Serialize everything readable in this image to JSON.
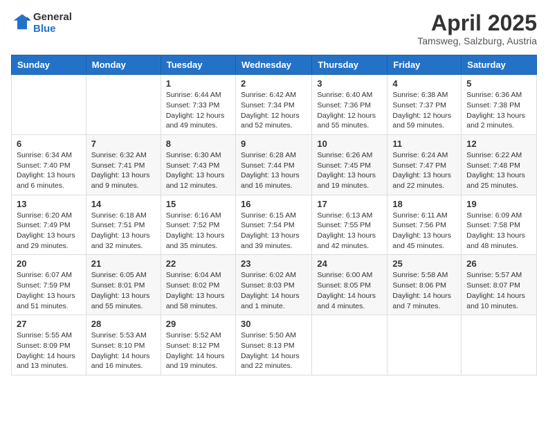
{
  "header": {
    "logo_general": "General",
    "logo_blue": "Blue",
    "month": "April 2025",
    "location": "Tamsweg, Salzburg, Austria"
  },
  "days_of_week": [
    "Sunday",
    "Monday",
    "Tuesday",
    "Wednesday",
    "Thursday",
    "Friday",
    "Saturday"
  ],
  "weeks": [
    [
      {
        "day": "",
        "info": ""
      },
      {
        "day": "",
        "info": ""
      },
      {
        "day": "1",
        "info": "Sunrise: 6:44 AM\nSunset: 7:33 PM\nDaylight: 12 hours and 49 minutes."
      },
      {
        "day": "2",
        "info": "Sunrise: 6:42 AM\nSunset: 7:34 PM\nDaylight: 12 hours and 52 minutes."
      },
      {
        "day": "3",
        "info": "Sunrise: 6:40 AM\nSunset: 7:36 PM\nDaylight: 12 hours and 55 minutes."
      },
      {
        "day": "4",
        "info": "Sunrise: 6:38 AM\nSunset: 7:37 PM\nDaylight: 12 hours and 59 minutes."
      },
      {
        "day": "5",
        "info": "Sunrise: 6:36 AM\nSunset: 7:38 PM\nDaylight: 13 hours and 2 minutes."
      }
    ],
    [
      {
        "day": "6",
        "info": "Sunrise: 6:34 AM\nSunset: 7:40 PM\nDaylight: 13 hours and 6 minutes."
      },
      {
        "day": "7",
        "info": "Sunrise: 6:32 AM\nSunset: 7:41 PM\nDaylight: 13 hours and 9 minutes."
      },
      {
        "day": "8",
        "info": "Sunrise: 6:30 AM\nSunset: 7:43 PM\nDaylight: 13 hours and 12 minutes."
      },
      {
        "day": "9",
        "info": "Sunrise: 6:28 AM\nSunset: 7:44 PM\nDaylight: 13 hours and 16 minutes."
      },
      {
        "day": "10",
        "info": "Sunrise: 6:26 AM\nSunset: 7:45 PM\nDaylight: 13 hours and 19 minutes."
      },
      {
        "day": "11",
        "info": "Sunrise: 6:24 AM\nSunset: 7:47 PM\nDaylight: 13 hours and 22 minutes."
      },
      {
        "day": "12",
        "info": "Sunrise: 6:22 AM\nSunset: 7:48 PM\nDaylight: 13 hours and 25 minutes."
      }
    ],
    [
      {
        "day": "13",
        "info": "Sunrise: 6:20 AM\nSunset: 7:49 PM\nDaylight: 13 hours and 29 minutes."
      },
      {
        "day": "14",
        "info": "Sunrise: 6:18 AM\nSunset: 7:51 PM\nDaylight: 13 hours and 32 minutes."
      },
      {
        "day": "15",
        "info": "Sunrise: 6:16 AM\nSunset: 7:52 PM\nDaylight: 13 hours and 35 minutes."
      },
      {
        "day": "16",
        "info": "Sunrise: 6:15 AM\nSunset: 7:54 PM\nDaylight: 13 hours and 39 minutes."
      },
      {
        "day": "17",
        "info": "Sunrise: 6:13 AM\nSunset: 7:55 PM\nDaylight: 13 hours and 42 minutes."
      },
      {
        "day": "18",
        "info": "Sunrise: 6:11 AM\nSunset: 7:56 PM\nDaylight: 13 hours and 45 minutes."
      },
      {
        "day": "19",
        "info": "Sunrise: 6:09 AM\nSunset: 7:58 PM\nDaylight: 13 hours and 48 minutes."
      }
    ],
    [
      {
        "day": "20",
        "info": "Sunrise: 6:07 AM\nSunset: 7:59 PM\nDaylight: 13 hours and 51 minutes."
      },
      {
        "day": "21",
        "info": "Sunrise: 6:05 AM\nSunset: 8:01 PM\nDaylight: 13 hours and 55 minutes."
      },
      {
        "day": "22",
        "info": "Sunrise: 6:04 AM\nSunset: 8:02 PM\nDaylight: 13 hours and 58 minutes."
      },
      {
        "day": "23",
        "info": "Sunrise: 6:02 AM\nSunset: 8:03 PM\nDaylight: 14 hours and 1 minute."
      },
      {
        "day": "24",
        "info": "Sunrise: 6:00 AM\nSunset: 8:05 PM\nDaylight: 14 hours and 4 minutes."
      },
      {
        "day": "25",
        "info": "Sunrise: 5:58 AM\nSunset: 8:06 PM\nDaylight: 14 hours and 7 minutes."
      },
      {
        "day": "26",
        "info": "Sunrise: 5:57 AM\nSunset: 8:07 PM\nDaylight: 14 hours and 10 minutes."
      }
    ],
    [
      {
        "day": "27",
        "info": "Sunrise: 5:55 AM\nSunset: 8:09 PM\nDaylight: 14 hours and 13 minutes."
      },
      {
        "day": "28",
        "info": "Sunrise: 5:53 AM\nSunset: 8:10 PM\nDaylight: 14 hours and 16 minutes."
      },
      {
        "day": "29",
        "info": "Sunrise: 5:52 AM\nSunset: 8:12 PM\nDaylight: 14 hours and 19 minutes."
      },
      {
        "day": "30",
        "info": "Sunrise: 5:50 AM\nSunset: 8:13 PM\nDaylight: 14 hours and 22 minutes."
      },
      {
        "day": "",
        "info": ""
      },
      {
        "day": "",
        "info": ""
      },
      {
        "day": "",
        "info": ""
      }
    ]
  ]
}
